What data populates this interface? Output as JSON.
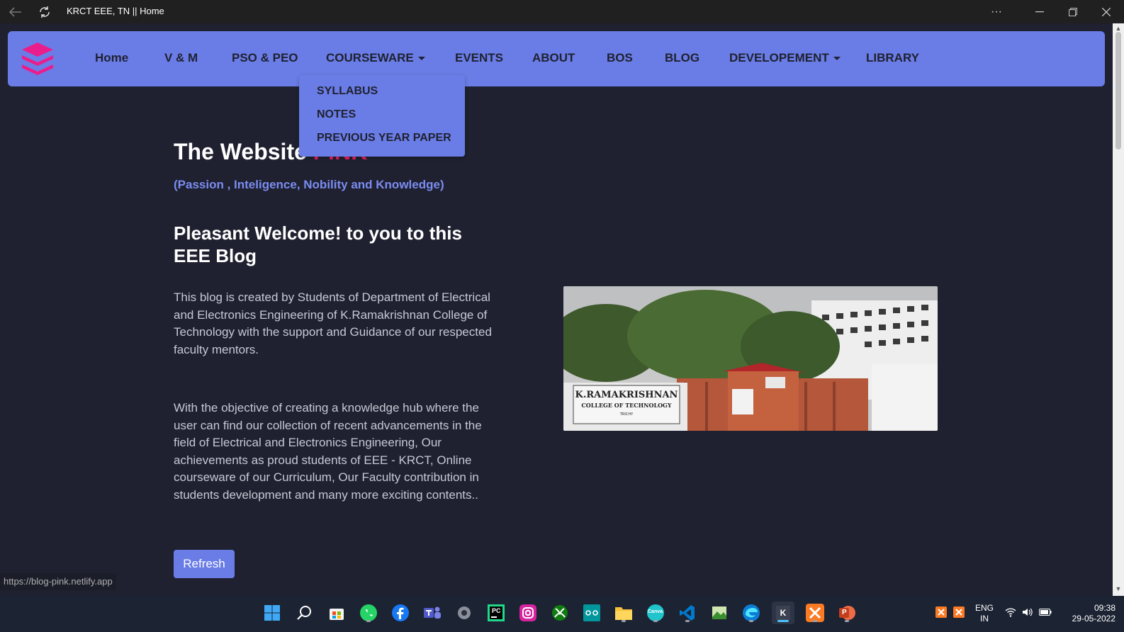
{
  "window": {
    "title": "KRCT EEE, TN || Home",
    "more_label": "···"
  },
  "nav": {
    "items": [
      {
        "label": "Home"
      },
      {
        "label": "V & M"
      },
      {
        "label": "PSO & PEO"
      },
      {
        "label": "COURSEWARE"
      },
      {
        "label": "EVENTS"
      },
      {
        "label": "ABOUT"
      },
      {
        "label": "BOS"
      },
      {
        "label": "BLOG"
      },
      {
        "label": "DEVELOPEMENT"
      },
      {
        "label": "LIBRARY"
      }
    ],
    "dropdown": [
      "SYLLABUS",
      "NOTES",
      "PREVIOUS YEAR PAPER"
    ]
  },
  "hero": {
    "title": "The Website ",
    "title_accent": "PINK",
    "subtitle": "(Passion , Inteligence, Nobility and Knowledge)",
    "welcome": "Pleasant Welcome! to you to this EEE Blog",
    "para1": "This blog is created by Students of Department of Electrical and Electronics Engineering of K.Ramakrishnan College of Technology with the support and Guidance of our respected faculty mentors.",
    "para2": "With the objective of creating a knowledge hub where the user can find our collection of recent advancements in the field of Electrical and Electronics Engineering, Our achievements as proud students of EEE - KRCT, Online courseware of our Curriculum, Our Faculty contribution in students development and many more exciting contents..",
    "refresh_label": "Refresh"
  },
  "photo": {
    "sign_line1": "K.RAMAKRISHNAN",
    "sign_line2": "COLLEGE OF TECHNOLOGY",
    "sign_line3": "TRICHY"
  },
  "status_url": "https://blog-pink.netlify.app",
  "taskbar": {
    "language_line1": "ENG",
    "language_line2": "IN",
    "time": "09:38",
    "date": "29-05-2022",
    "app_labels": {
      "pycharm": "PC",
      "krct": "K",
      "powerpoint": "P",
      "canva": "Canva"
    }
  },
  "colors": {
    "navbar": "#6a7de6",
    "accent_pink": "#e91e63",
    "background": "#1f2130"
  }
}
